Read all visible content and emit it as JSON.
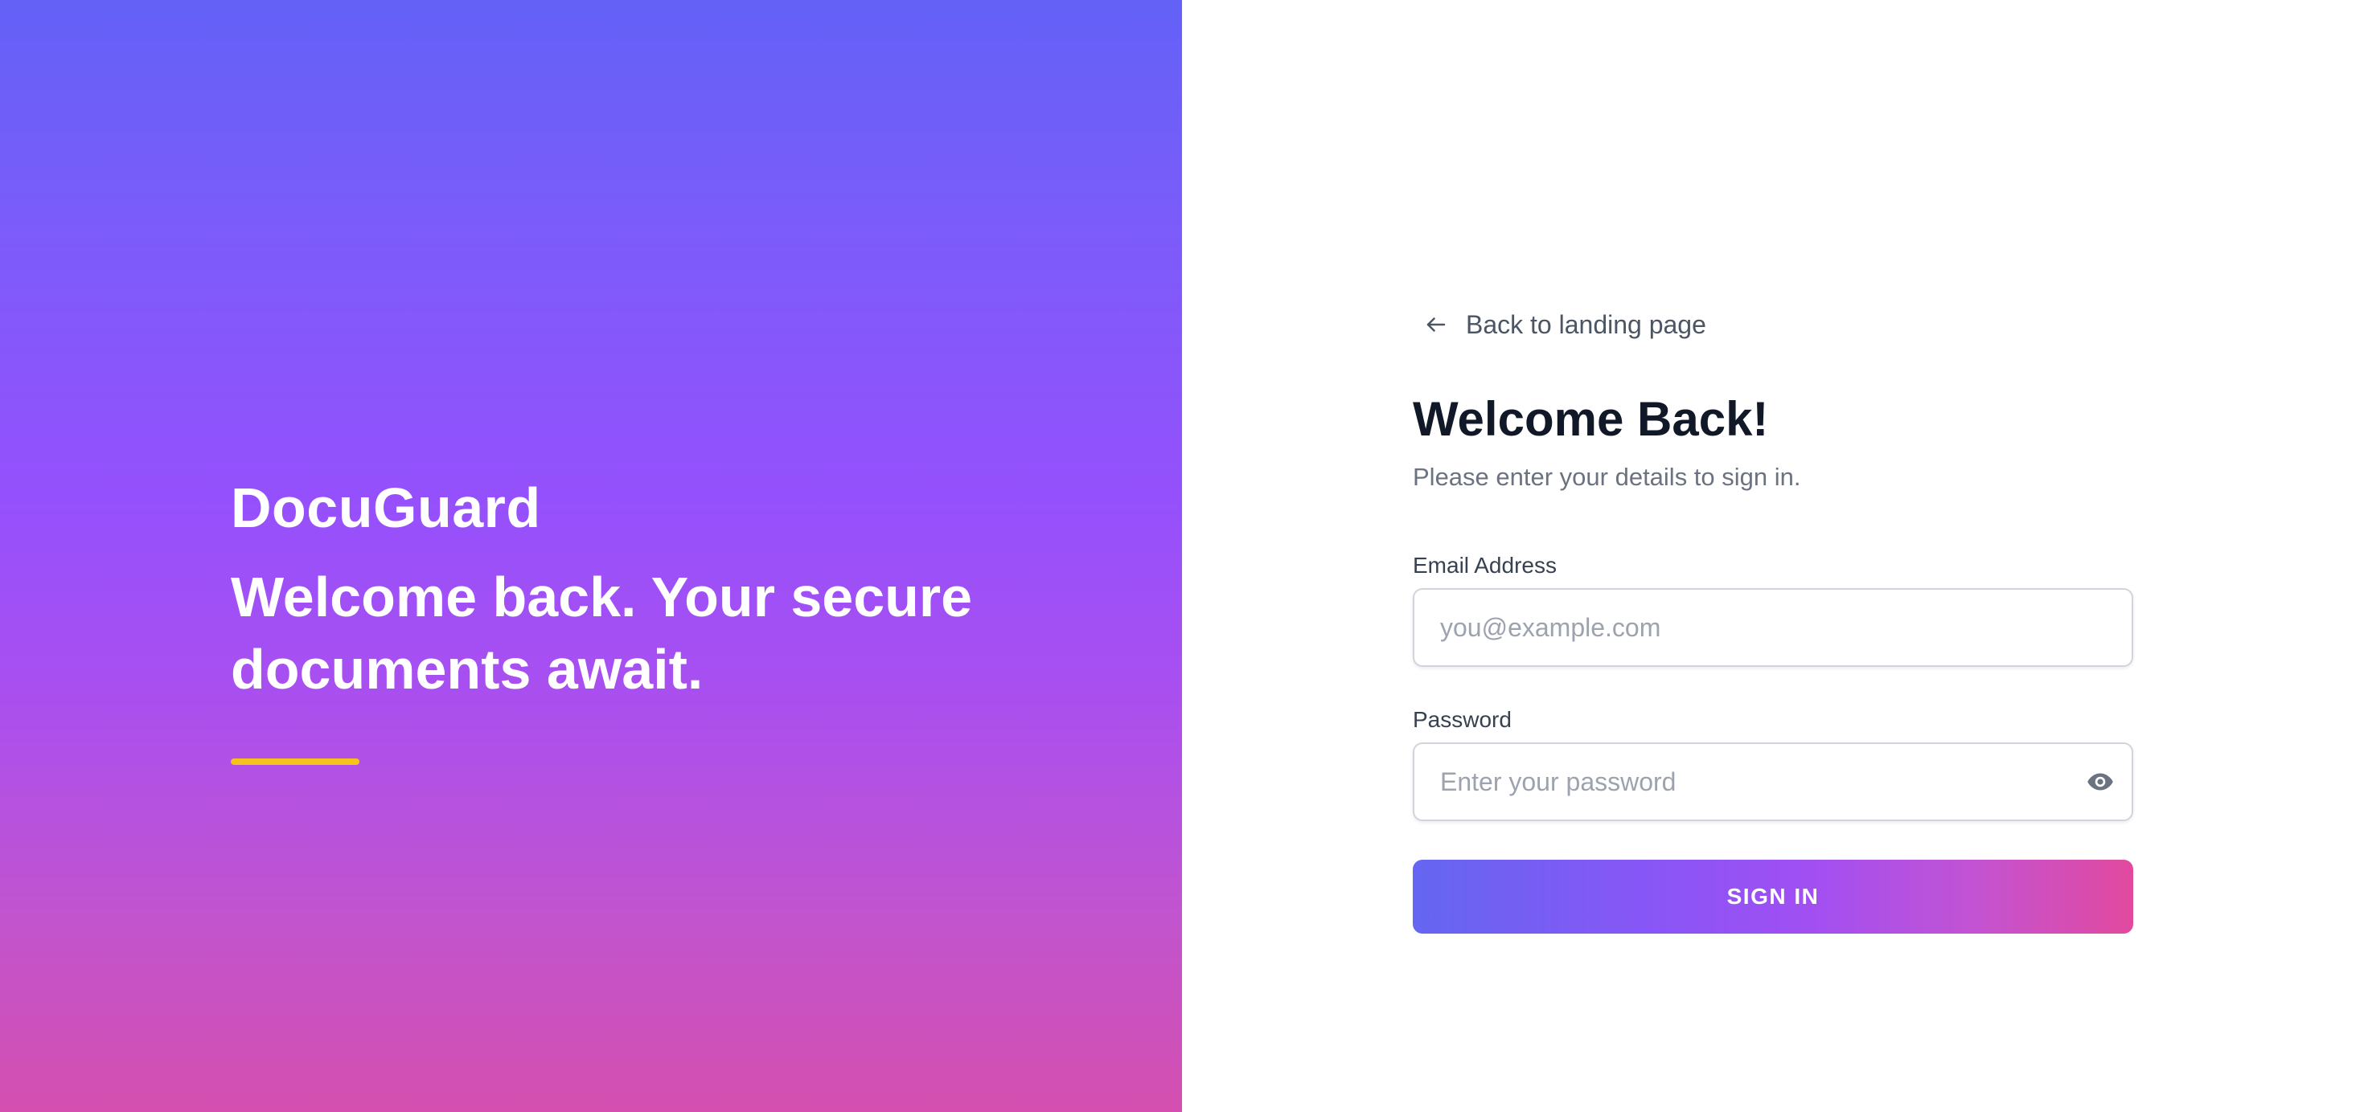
{
  "hero": {
    "brand": "DocuGuard",
    "tagline": "Welcome back. Your secure documents await.",
    "accent_color": "#f6c21b",
    "gradient_top": "#6361f7",
    "gradient_bottom": "#d44faf"
  },
  "form": {
    "back_link_label": "Back to landing page",
    "back_icon": "arrow-left-icon",
    "title": "Welcome Back!",
    "subtitle": "Please enter your details to sign in.",
    "email": {
      "label": "Email Address",
      "placeholder": "you@example.com",
      "value": ""
    },
    "password": {
      "label": "Password",
      "placeholder": "Enter your password",
      "value": "",
      "toggle_icon": "eye-icon"
    },
    "submit_label": "SIGN IN",
    "button_gradient_start": "#6466f1",
    "button_gradient_end": "#e2499e"
  }
}
